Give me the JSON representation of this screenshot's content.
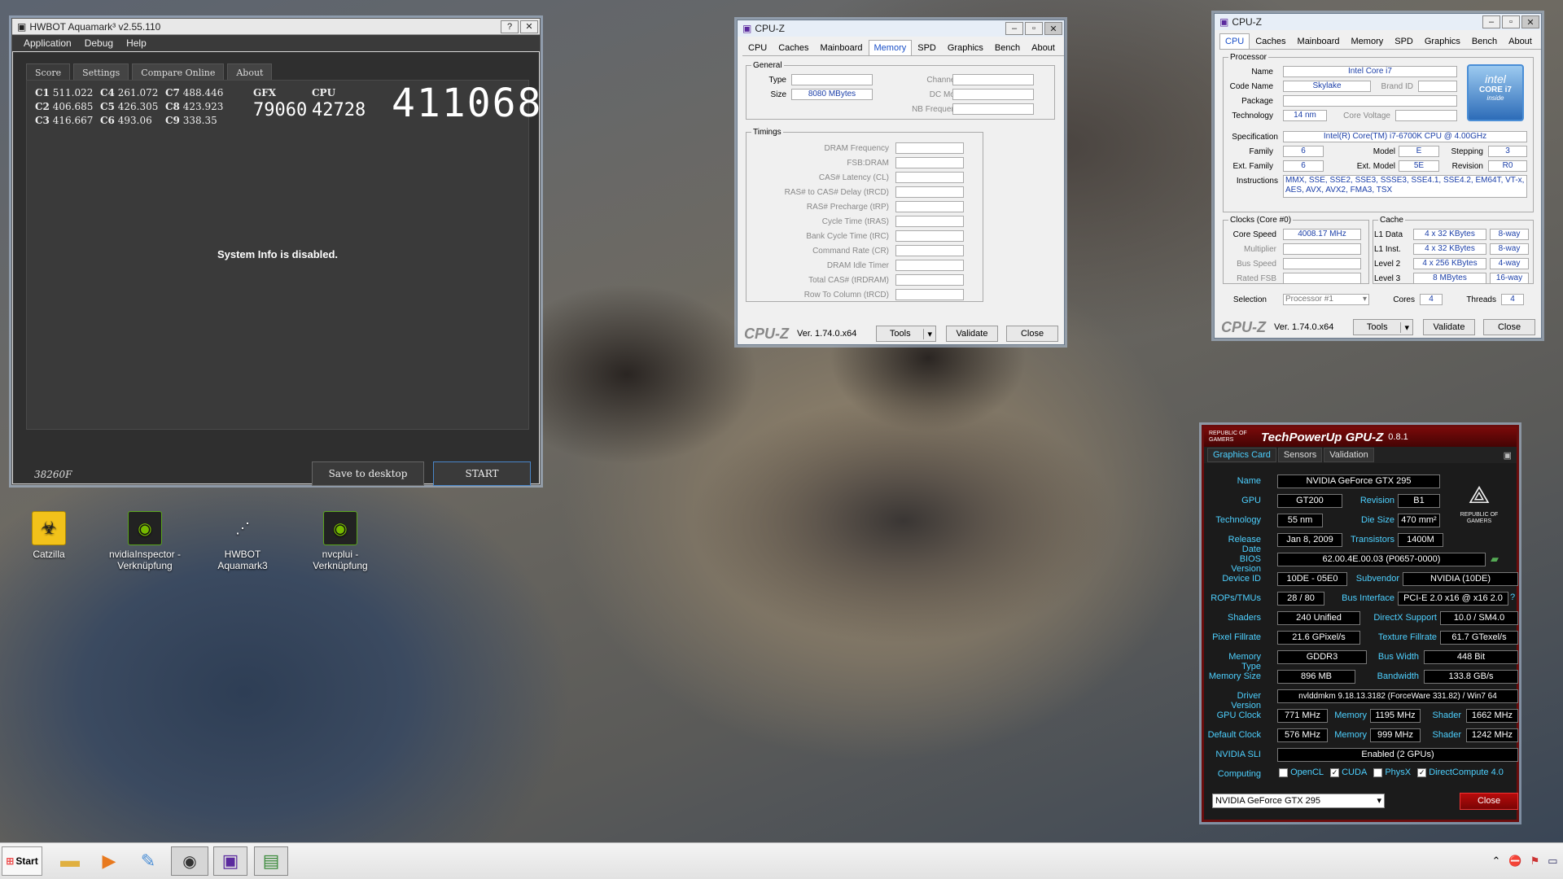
{
  "aquamark": {
    "title": "HWBOT Aquamark³ v2.55.110",
    "help_btn": "?",
    "close_btn": "✕",
    "menu": [
      "Application",
      "Debug",
      "Help"
    ],
    "tabs": [
      "Score",
      "Settings",
      "Compare Online",
      "About"
    ],
    "c_scores": [
      {
        "label": "C1",
        "value": "511.022"
      },
      {
        "label": "C4",
        "value": "261.072"
      },
      {
        "label": "C7",
        "value": "488.446"
      },
      {
        "label": "C2",
        "value": "406.685"
      },
      {
        "label": "C5",
        "value": "426.305"
      },
      {
        "label": "C8",
        "value": "423.923"
      },
      {
        "label": "C3",
        "value": "416.667"
      },
      {
        "label": "C6",
        "value": "493.06"
      },
      {
        "label": "C9",
        "value": "338.35"
      }
    ],
    "gfx_label": "GFX",
    "gfx_value": "79060",
    "cpu_label": "CPU",
    "cpu_value": "42728",
    "total_score": "411068",
    "system_info": "System Info is disabled.",
    "code": "38260F",
    "save_button": "Save to desktop",
    "start_button": "START"
  },
  "cpuz_memory": {
    "title": "CPU-Z",
    "tabs": [
      "CPU",
      "Caches",
      "Mainboard",
      "Memory",
      "SPD",
      "Graphics",
      "Bench",
      "About"
    ],
    "active_tab": "Memory",
    "general_legend": "General",
    "type_label": "Type",
    "type_value": "",
    "size_label": "Size",
    "size_value": "8080 MBytes",
    "channel_label": "Channel #",
    "dc_mode_label": "DC Mode",
    "nb_freq_label": "NB Frequency",
    "timings_legend": "Timings",
    "timings": [
      "DRAM Frequency",
      "FSB:DRAM",
      "CAS# Latency (CL)",
      "RAS# to CAS# Delay (tRCD)",
      "RAS# Precharge (tRP)",
      "Cycle Time (tRAS)",
      "Bank Cycle Time (tRC)",
      "Command Rate (CR)",
      "DRAM Idle Timer",
      "Total CAS# (tRDRAM)",
      "Row To Column (tRCD)"
    ],
    "logo": "CPU-Z",
    "version": "Ver. 1.74.0.x64",
    "tools_button": "Tools",
    "validate_button": "Validate",
    "close_button": "Close"
  },
  "cpuz_cpu": {
    "title": "CPU-Z",
    "tabs": [
      "CPU",
      "Caches",
      "Mainboard",
      "Memory",
      "SPD",
      "Graphics",
      "Bench",
      "About"
    ],
    "active_tab": "CPU",
    "processor_legend": "Processor",
    "name_label": "Name",
    "name_value": "Intel Core i7",
    "code_name_label": "Code Name",
    "code_name_value": "Skylake",
    "brand_id_label": "Brand ID",
    "package_label": "Package",
    "technology_label": "Technology",
    "technology_value": "14 nm",
    "core_voltage_label": "Core Voltage",
    "spec_label": "Specification",
    "spec_value": "Intel(R) Core(TM) i7-6700K CPU @ 4.00GHz",
    "family_label": "Family",
    "family_value": "6",
    "model_label": "Model",
    "model_value": "E",
    "stepping_label": "Stepping",
    "stepping_value": "3",
    "ext_family_label": "Ext. Family",
    "ext_family_value": "6",
    "ext_model_label": "Ext. Model",
    "ext_model_value": "5E",
    "revision_label": "Revision",
    "revision_value": "R0",
    "instructions_label": "Instructions",
    "instructions_value": "MMX, SSE, SSE2, SSE3, SSSE3, SSE4.1, SSE4.2, EM64T, VT-x, AES, AVX, AVX2, FMA3, TSX",
    "intel_logo_top": "intel",
    "intel_logo_mid": "CORE i7",
    "intel_logo_bot": "inside",
    "clocks_legend": "Clocks (Core #0)",
    "core_speed_label": "Core Speed",
    "core_speed_value": "4008.17 MHz",
    "multiplier_label": "Multiplier",
    "bus_speed_label": "Bus Speed",
    "rated_fsb_label": "Rated FSB",
    "cache_legend": "Cache",
    "l1d_label": "L1 Data",
    "l1d_value": "4 x 32 KBytes",
    "l1d_way": "8-way",
    "l1i_label": "L1 Inst.",
    "l1i_value": "4 x 32 KBytes",
    "l1i_way": "8-way",
    "l2_label": "Level 2",
    "l2_value": "4 x 256 KBytes",
    "l2_way": "4-way",
    "l3_label": "Level 3",
    "l3_value": "8 MBytes",
    "l3_way": "16-way",
    "selection_label": "Selection",
    "selection_value": "Processor #1",
    "cores_label": "Cores",
    "cores_value": "4",
    "threads_label": "Threads",
    "threads_value": "4",
    "logo": "CPU-Z",
    "version": "Ver. 1.74.0.x64",
    "tools_button": "Tools",
    "validate_button": "Validate",
    "close_button": "Close"
  },
  "gpuz": {
    "rog_small": "REPUBLIC OF GAMERS",
    "title": "TechPowerUp GPU-Z",
    "version": "0.8.1",
    "tabs": [
      "Graphics Card",
      "Sensors",
      "Validation"
    ],
    "rows": {
      "name_label": "Name",
      "name_value": "NVIDIA GeForce GTX 295",
      "gpu_label": "GPU",
      "gpu_value": "GT200",
      "revision_label": "Revision",
      "revision_value": "B1",
      "technology_label": "Technology",
      "technology_value": "55 nm",
      "die_size_label": "Die Size",
      "die_size_value": "470 mm²",
      "release_label": "Release Date",
      "release_value": "Jan 8, 2009",
      "transistors_label": "Transistors",
      "transistors_value": "1400M",
      "bios_label": "BIOS Version",
      "bios_value": "62.00.4E.00.03 (P0657-0000)",
      "device_id_label": "Device ID",
      "device_id_value": "10DE - 05E0",
      "subvendor_label": "Subvendor",
      "subvendor_value": "NVIDIA (10DE)",
      "rops_label": "ROPs/TMUs",
      "rops_value": "28 / 80",
      "bus_interface_label": "Bus Interface",
      "bus_interface_value": "PCI-E 2.0 x16 @ x16 2.0",
      "shaders_label": "Shaders",
      "shaders_value": "240 Unified",
      "directx_label": "DirectX Support",
      "directx_value": "10.0 / SM4.0",
      "pixel_label": "Pixel Fillrate",
      "pixel_value": "21.6 GPixel/s",
      "texture_label": "Texture Fillrate",
      "texture_value": "61.7 GTexel/s",
      "memtype_label": "Memory Type",
      "memtype_value": "GDDR3",
      "buswidth_label": "Bus Width",
      "buswidth_value": "448 Bit",
      "memsize_label": "Memory Size",
      "memsize_value": "896 MB",
      "bandwidth_label": "Bandwidth",
      "bandwidth_value": "133.8 GB/s",
      "driver_label": "Driver Version",
      "driver_value": "nvlddmkm 9.18.13.3182 (ForceWare 331.82) / Win7 64",
      "gpuclock_label": "GPU Clock",
      "gpuclock_value": "771 MHz",
      "memory_label": "Memory",
      "memory_value": "1195 MHz",
      "shader_label": "Shader",
      "shader_value": "1662 MHz",
      "defclock_label": "Default Clock",
      "defclock_value": "576 MHz",
      "defmemory_value": "999 MHz",
      "defshader_value": "1242 MHz",
      "sli_label": "NVIDIA SLI",
      "sli_value": "Enabled (2 GPUs)",
      "computing_label": "Computing",
      "opencl_label": "OpenCL",
      "cuda_label": "CUDA",
      "physx_label": "PhysX",
      "dc_label": "DirectCompute 4.0"
    },
    "gpu_select": "NVIDIA GeForce GTX 295",
    "close_button": "Close"
  },
  "desktop_icons": [
    {
      "label": "Catzilla",
      "color": "#f2c21a"
    },
    {
      "label": "nvidiaInspector - Verknüpfung",
      "color": "#5aa51c"
    },
    {
      "label": "HWBOT Aquamark3",
      "color": "#e8e8e8"
    },
    {
      "label": "nvcplui - Verknüpfung",
      "color": "#5aa51c"
    }
  ],
  "taskbar": {
    "start_label": "Start"
  }
}
